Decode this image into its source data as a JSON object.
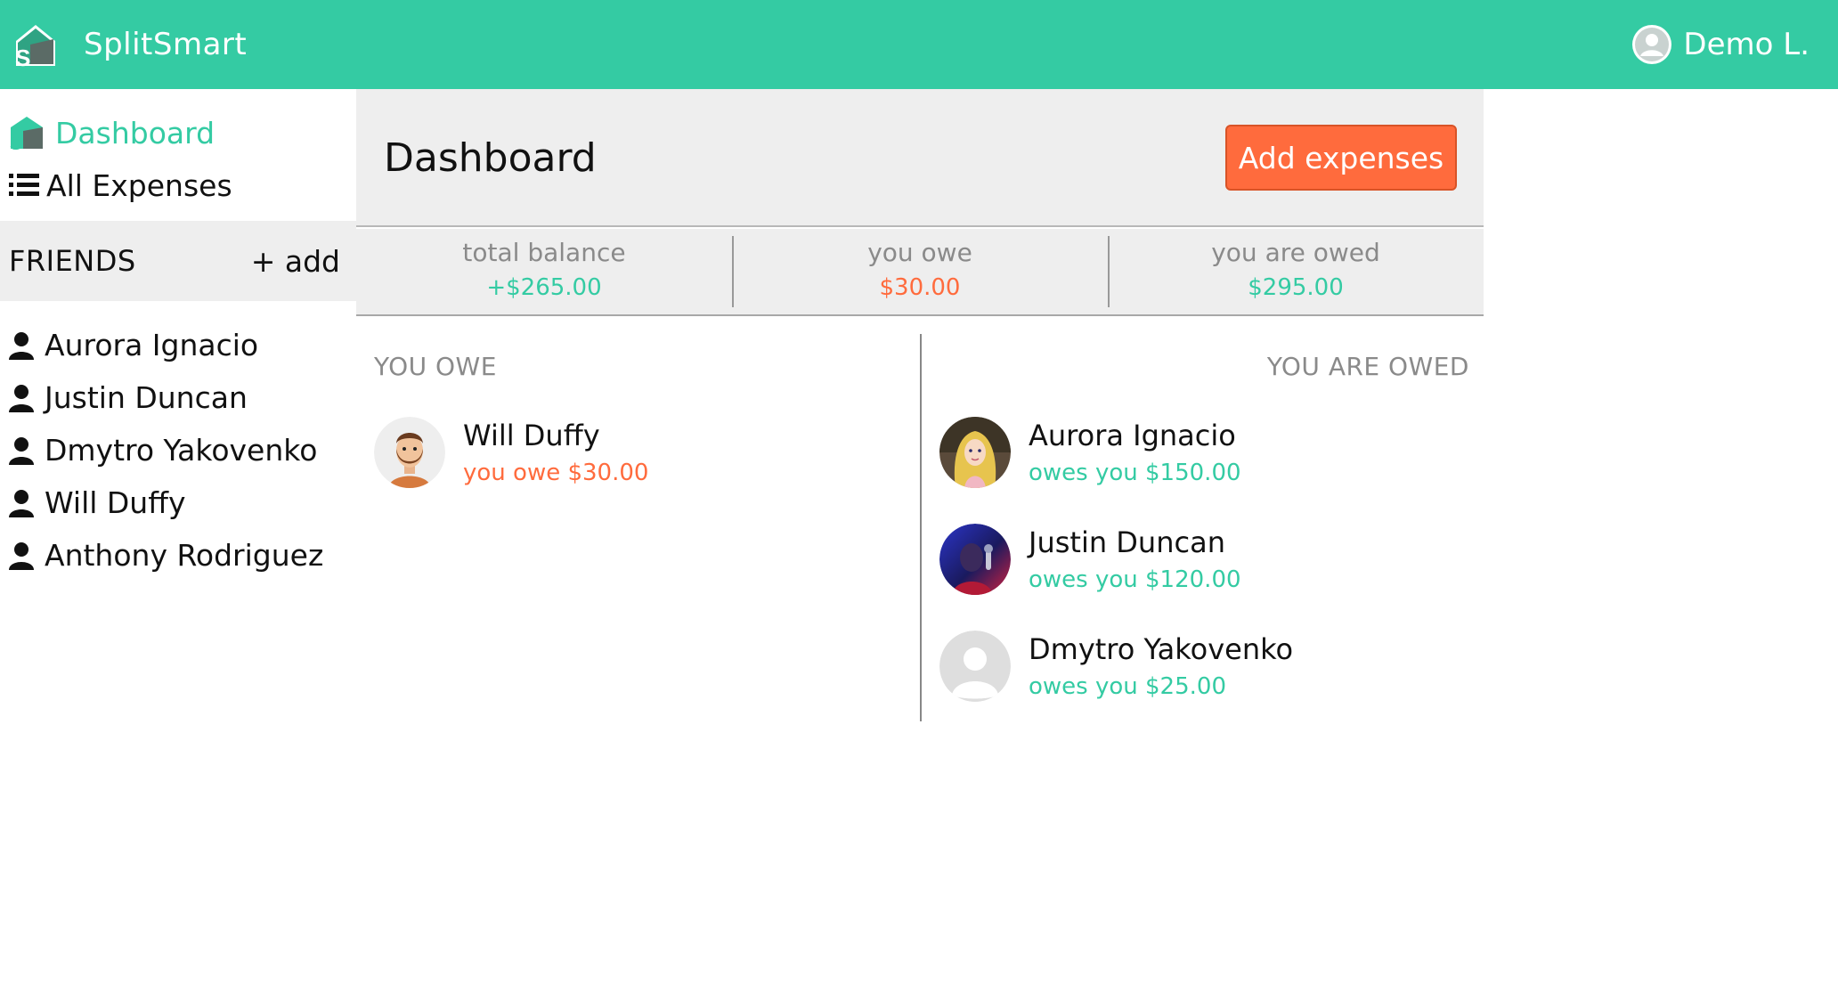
{
  "app": {
    "name": "SplitSmart",
    "user": "Demo L.",
    "accent_color": "#34cba3",
    "alert_color": "#ff6b3d"
  },
  "sidebar": {
    "nav": [
      {
        "label": "Dashboard",
        "icon": "splitsmart-logo-icon",
        "active": true
      },
      {
        "label": "All Expenses",
        "icon": "list-icon",
        "active": false
      }
    ],
    "friends_title": "FRIENDS",
    "add_label": "+ add",
    "friends": [
      "Aurora Ignacio",
      "Justin Duncan",
      "Dmytro Yakovenko",
      "Will Duffy",
      "Anthony Rodriguez"
    ]
  },
  "main": {
    "title": "Dashboard",
    "add_button": "Add expenses",
    "balances": [
      {
        "label": "total balance",
        "value": "+$265.00",
        "tone": "green"
      },
      {
        "label": "you owe",
        "value": "$30.00",
        "tone": "orange"
      },
      {
        "label": "you are owed",
        "value": "$295.00",
        "tone": "green"
      }
    ],
    "you_owe": {
      "title": "YOU OWE",
      "people": [
        {
          "name": "Will Duffy",
          "detail": "you owe $30.00",
          "avatar": "bearded-man-avatar"
        }
      ]
    },
    "you_are_owed": {
      "title": "YOU ARE OWED",
      "people": [
        {
          "name": "Aurora Ignacio",
          "detail": "owes you $150.00",
          "avatar": "princess-avatar"
        },
        {
          "name": "Justin Duncan",
          "detail": "owes you $120.00",
          "avatar": "neon-performer-avatar"
        },
        {
          "name": "Dmytro Yakovenko",
          "detail": "owes you $25.00",
          "avatar": "default-user-avatar"
        }
      ]
    }
  }
}
